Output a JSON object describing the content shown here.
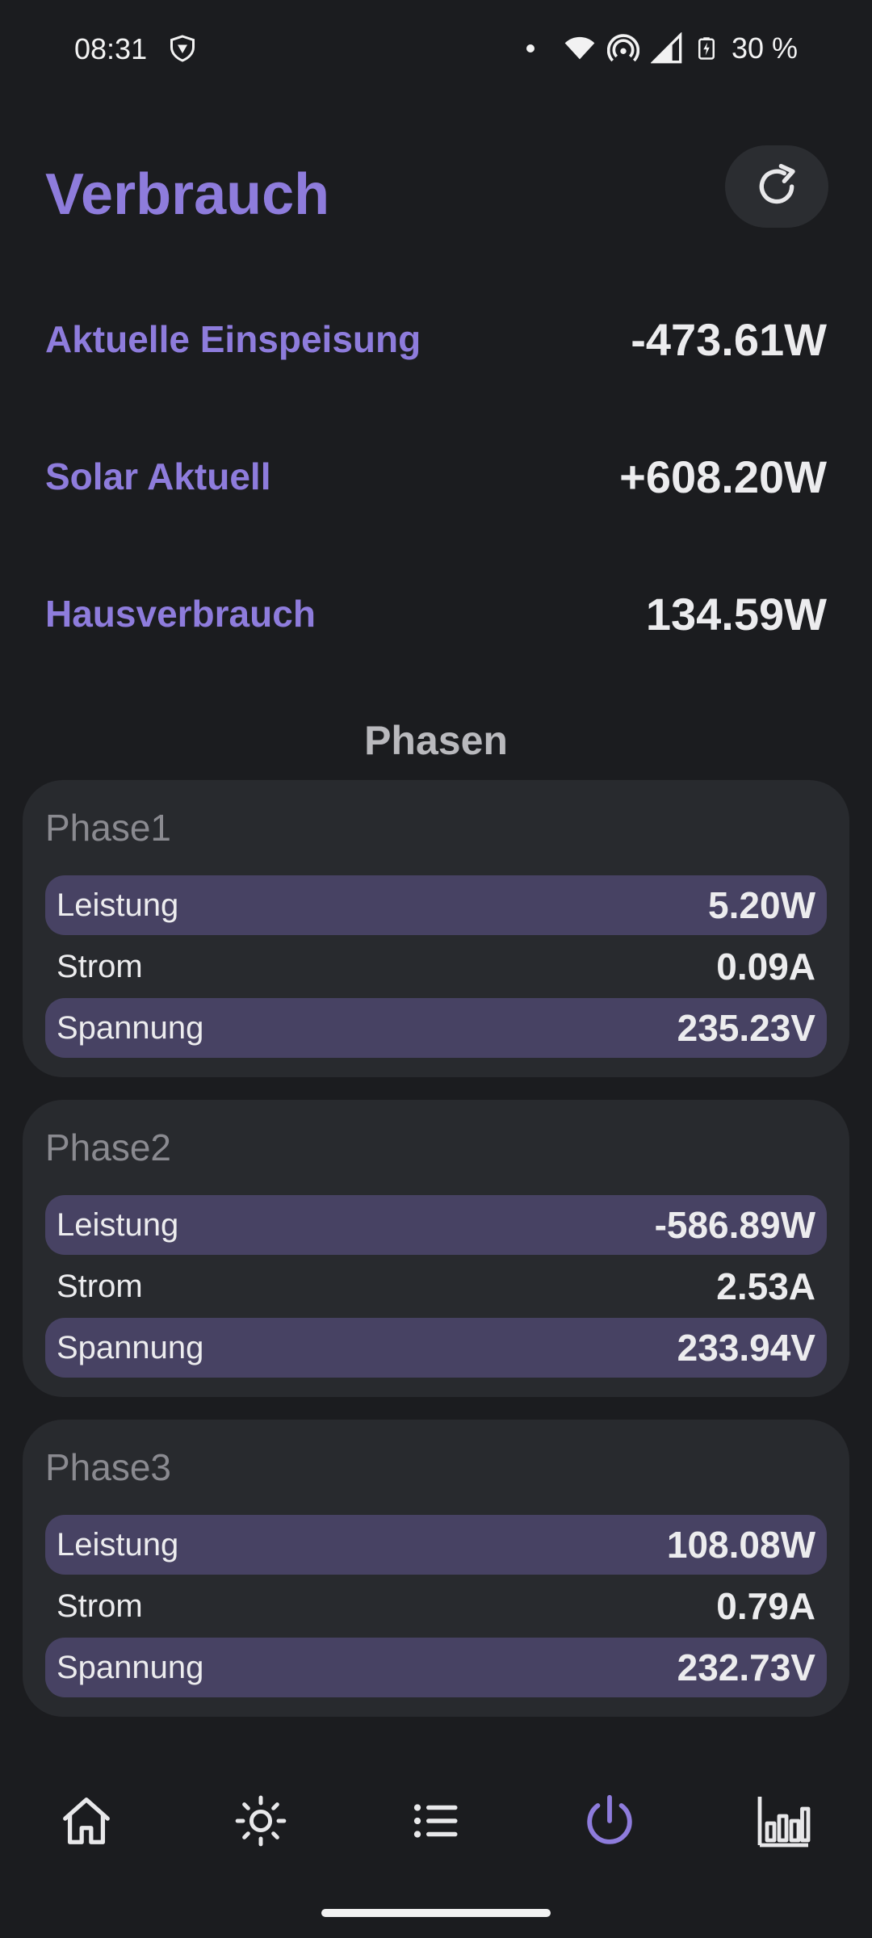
{
  "status_bar": {
    "time": "08:31",
    "battery": "30 %",
    "icons": [
      "vpn-shield-icon",
      "notification-dot-icon",
      "wifi-icon",
      "hotspot-icon",
      "signal-icon",
      "battery-charging-icon"
    ]
  },
  "header": {
    "title": "Verbrauch",
    "refresh_icon": "refresh-icon"
  },
  "summary": [
    {
      "label": "Aktuelle Einspeisung",
      "value": "-473.61W"
    },
    {
      "label": "Solar Aktuell",
      "value": "+608.20W"
    },
    {
      "label": "Hausverbrauch",
      "value": "134.59W"
    }
  ],
  "phases_heading": "Phasen",
  "phases": [
    {
      "title": "Phase1",
      "rows": [
        {
          "label": "Leistung",
          "value": "5.20W"
        },
        {
          "label": "Strom",
          "value": "0.09A"
        },
        {
          "label": "Spannung",
          "value": "235.23V"
        }
      ]
    },
    {
      "title": "Phase2",
      "rows": [
        {
          "label": "Leistung",
          "value": "-586.89W"
        },
        {
          "label": "Strom",
          "value": "2.53A"
        },
        {
          "label": "Spannung",
          "value": "233.94V"
        }
      ]
    },
    {
      "title": "Phase3",
      "rows": [
        {
          "label": "Leistung",
          "value": "108.08W"
        },
        {
          "label": "Strom",
          "value": "0.79A"
        },
        {
          "label": "Spannung",
          "value": "232.73V"
        }
      ]
    }
  ],
  "bottom_nav": {
    "items": [
      "home-icon",
      "sun-icon",
      "list-icon",
      "power-icon",
      "bar-chart-icon"
    ],
    "active": "power-icon"
  },
  "colors": {
    "accent": "#8e7cdc",
    "background": "#1b1c1f",
    "card": "#282a2e",
    "row_highlight": "#474263",
    "text": "#ececee"
  }
}
